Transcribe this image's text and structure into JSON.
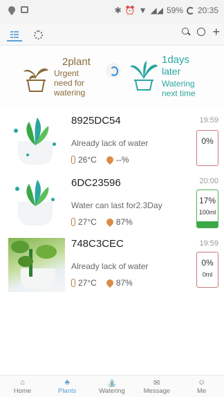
{
  "statusbar": {
    "battery_pct": "59%",
    "time": "20:35"
  },
  "summary": {
    "urgent_count": "2plant",
    "urgent_desc": [
      "Urgent",
      "need for",
      "watering"
    ],
    "next_count": "1days",
    "next_desc": [
      "later",
      "Watering",
      "next time"
    ]
  },
  "plants": [
    {
      "id": "8925DC54",
      "status": "Already lack of water",
      "temp": "26°C",
      "humidity": "--%",
      "time": "19:59",
      "level_pct": "0%",
      "level_ml": "",
      "level_fill": 0,
      "level_color": "#c47a7a"
    },
    {
      "id": "6DC23596",
      "status": "Water can last for2.3Day",
      "temp": "27°C",
      "humidity": "87%",
      "time": "20:00",
      "level_pct": "17%",
      "level_ml": "100ml",
      "level_fill": 0.17,
      "level_color": "#4fae4f"
    },
    {
      "id": "748C3CEC",
      "status": "Already lack of water",
      "temp": "27°C",
      "humidity": "87%",
      "time": "19:59",
      "level_pct": "0%",
      "level_ml": "0ml",
      "level_fill": 0,
      "level_color": "#c47a7a"
    }
  ],
  "nav": {
    "active": "Plants",
    "items": [
      "Home",
      "Plants",
      "Watering",
      "Message",
      "Me"
    ]
  },
  "colors": {
    "accent": "#5a9fd6",
    "teal": "#2ba6a0",
    "brown": "#8a6a3a",
    "water_green": "#3aa847"
  }
}
